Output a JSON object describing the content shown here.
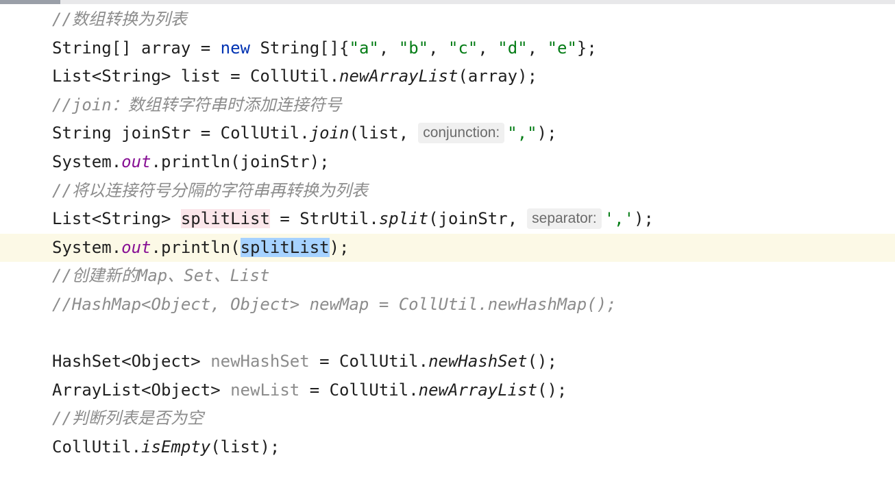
{
  "editor": {
    "lines": [
      {
        "comment": "//数组转换为列表"
      },
      {
        "t1": "String[] array = ",
        "kw": "new",
        "t2": " String[]{",
        "s1": "\"a\"",
        "c1": ", ",
        "s2": "\"b\"",
        "c2": ", ",
        "s3": "\"c\"",
        "c3": ", ",
        "s4": "\"d\"",
        "c4": ", ",
        "s5": "\"e\"",
        "t3": "};"
      },
      {
        "t1": "List<String> list = CollUtil.",
        "m": "newArrayList",
        "t2": "(array);"
      },
      {
        "comment": "//join：数组转字符串时添加连接符号"
      },
      {
        "t1": "String joinStr = CollUtil.",
        "m": "join",
        "t2": "(list,",
        "hint": "conjunction:",
        "s": "\",\"",
        "t3": ");"
      },
      {
        "t1": "System.",
        "f": "out",
        "t2": ".println(joinStr);"
      },
      {
        "comment": "//将以连接符号分隔的字符串再转换为列表"
      },
      {
        "t1": "List<String> ",
        "v": "splitList",
        "t2": " = StrUtil.",
        "m": "split",
        "t3": "(joinStr,",
        "hint": "separator:",
        "s": "','",
        "t4": ");"
      },
      {
        "t1": "System.",
        "f": "out",
        "t2": ".println(",
        "sel": "splitList",
        "t3": ");"
      },
      {
        "comment": "//创建新的Map、Set、List"
      },
      {
        "comment": "//HashMap<Object, Object> newMap = CollUtil.newHashMap();"
      },
      {
        "blank": ""
      },
      {
        "t1": "HashSet<Object> ",
        "u": "newHashSet",
        "t2": " = CollUtil.",
        "m": "newHashSet",
        "t3": "();"
      },
      {
        "t1": "ArrayList<Object> ",
        "u": "newList",
        "t2": " = CollUtil.",
        "m": "newArrayList",
        "t3": "();"
      },
      {
        "comment": "//判断列表是否为空"
      },
      {
        "t1": "CollUtil.",
        "m": "isEmpty",
        "t2": "(list);"
      }
    ]
  }
}
